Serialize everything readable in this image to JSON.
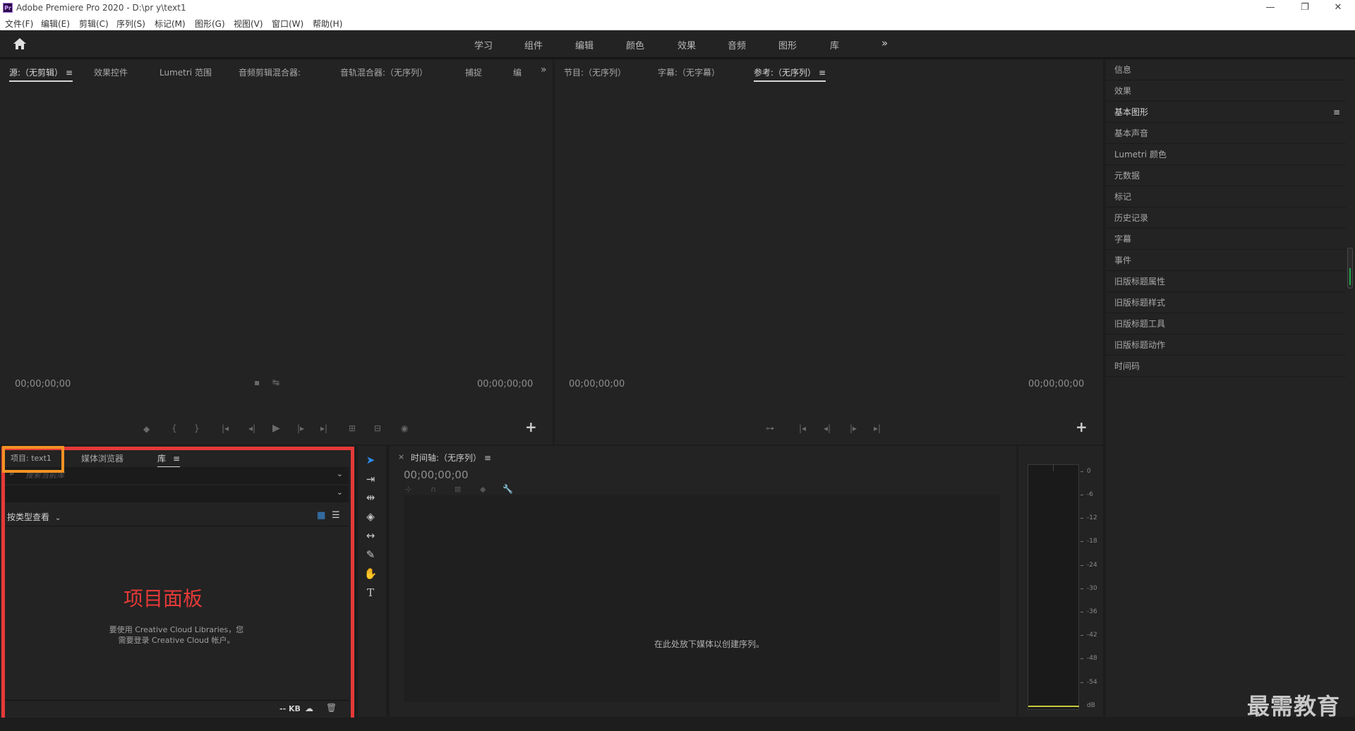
{
  "window": {
    "title": "Adobe Premiere Pro 2020 - D:\\pr y\\text1",
    "app_icon": "Pr"
  },
  "menu": [
    "文件(F)",
    "编辑(E)",
    "剪辑(C)",
    "序列(S)",
    "标记(M)",
    "图形(G)",
    "视图(V)",
    "窗口(W)",
    "帮助(H)"
  ],
  "workspaces": [
    "学习",
    "组件",
    "编辑",
    "颜色",
    "效果",
    "音频",
    "图形",
    "库"
  ],
  "source_panel": {
    "tabs": [
      "源:（无剪辑）",
      "效果控件",
      "Lumetri 范围",
      "音频剪辑混合器:",
      "音轨混合器:（无序列）",
      "捕捉",
      "编"
    ],
    "timecode_left": "00;00;00;00",
    "timecode_right": "00;00;00;00"
  },
  "program_panel": {
    "tabs": [
      "节目:（无序列）",
      "字幕:（无字幕）",
      "参考:（无序列）"
    ],
    "timecode_left": "00;00;00;00",
    "timecode_right": "00;00;00;00"
  },
  "right_panels": [
    "信息",
    "效果",
    "基本图形",
    "基本声音",
    "Lumetri 颜色",
    "元数据",
    "标记",
    "历史记录",
    "字幕",
    "事件",
    "旧版标题属性",
    "旧版标题样式",
    "旧版标题工具",
    "旧版标题动作",
    "时间码"
  ],
  "project_panel": {
    "tabs": [
      "项目: text1",
      "媒体浏览器",
      "库"
    ],
    "search_placeholder": "搜索当前库",
    "view_by": "按类型查看",
    "watermark": "项目面板",
    "cc_message_line1": "要使用 Creative Cloud Libraries，您",
    "cc_message_line2": "需要登录 Creative Cloud 帐户。",
    "size": "-- KB"
  },
  "timeline_panel": {
    "title": "时间轴:（无序列）",
    "timecode": "00;00;00;00",
    "drop_message": "在此处放下媒体以创建序列。"
  },
  "meter": {
    "scale": [
      "0",
      "-6",
      "-12",
      "-18",
      "-24",
      "-30",
      "-36",
      "-42",
      "-48",
      "-54",
      "dB"
    ]
  },
  "watermark": "最需教育"
}
